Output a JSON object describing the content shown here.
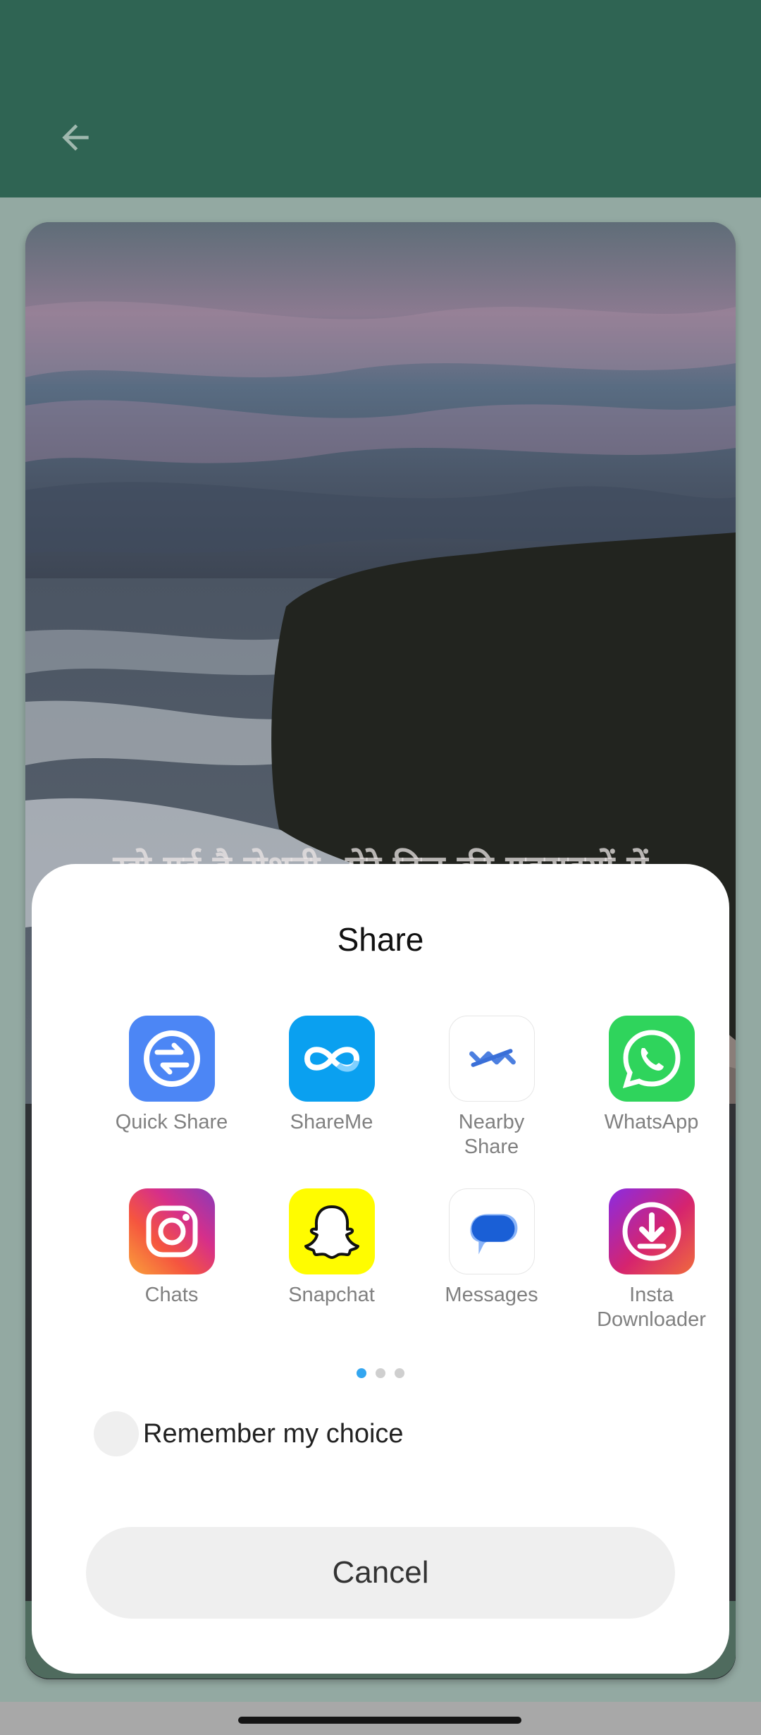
{
  "app_bar": {
    "back_icon": "arrow-left-icon"
  },
  "background": {
    "quote_text": "खो गई है रोशनी, मेरे दिल की गहराइयों में"
  },
  "share_sheet": {
    "title": "Share",
    "apps": [
      {
        "label": "Quick Share",
        "icon": "quick-share-icon",
        "color": "#4c86f5"
      },
      {
        "label": "ShareMe",
        "icon": "shareme-icon",
        "color": "#0aa0f0"
      },
      {
        "label": "Nearby\nShare",
        "icon": "nearby-share-icon",
        "color": "#ffffff"
      },
      {
        "label": "WhatsApp",
        "icon": "whatsapp-icon",
        "color": "#2fd45c"
      },
      {
        "label": "Chats",
        "icon": "instagram-icon",
        "color": "#d62f8a"
      },
      {
        "label": "Snapchat",
        "icon": "snapchat-icon",
        "color": "#fffc00"
      },
      {
        "label": "Messages",
        "icon": "messages-icon",
        "color": "#1a73e8"
      },
      {
        "label": "Insta\nDownloader",
        "icon": "insta-downloader-icon",
        "color": "#c8197c"
      }
    ],
    "page_indicator": {
      "pages": 3,
      "active": 0,
      "active_color": "#33a6f0"
    },
    "remember_label": "Remember my choice",
    "cancel_label": "Cancel"
  }
}
